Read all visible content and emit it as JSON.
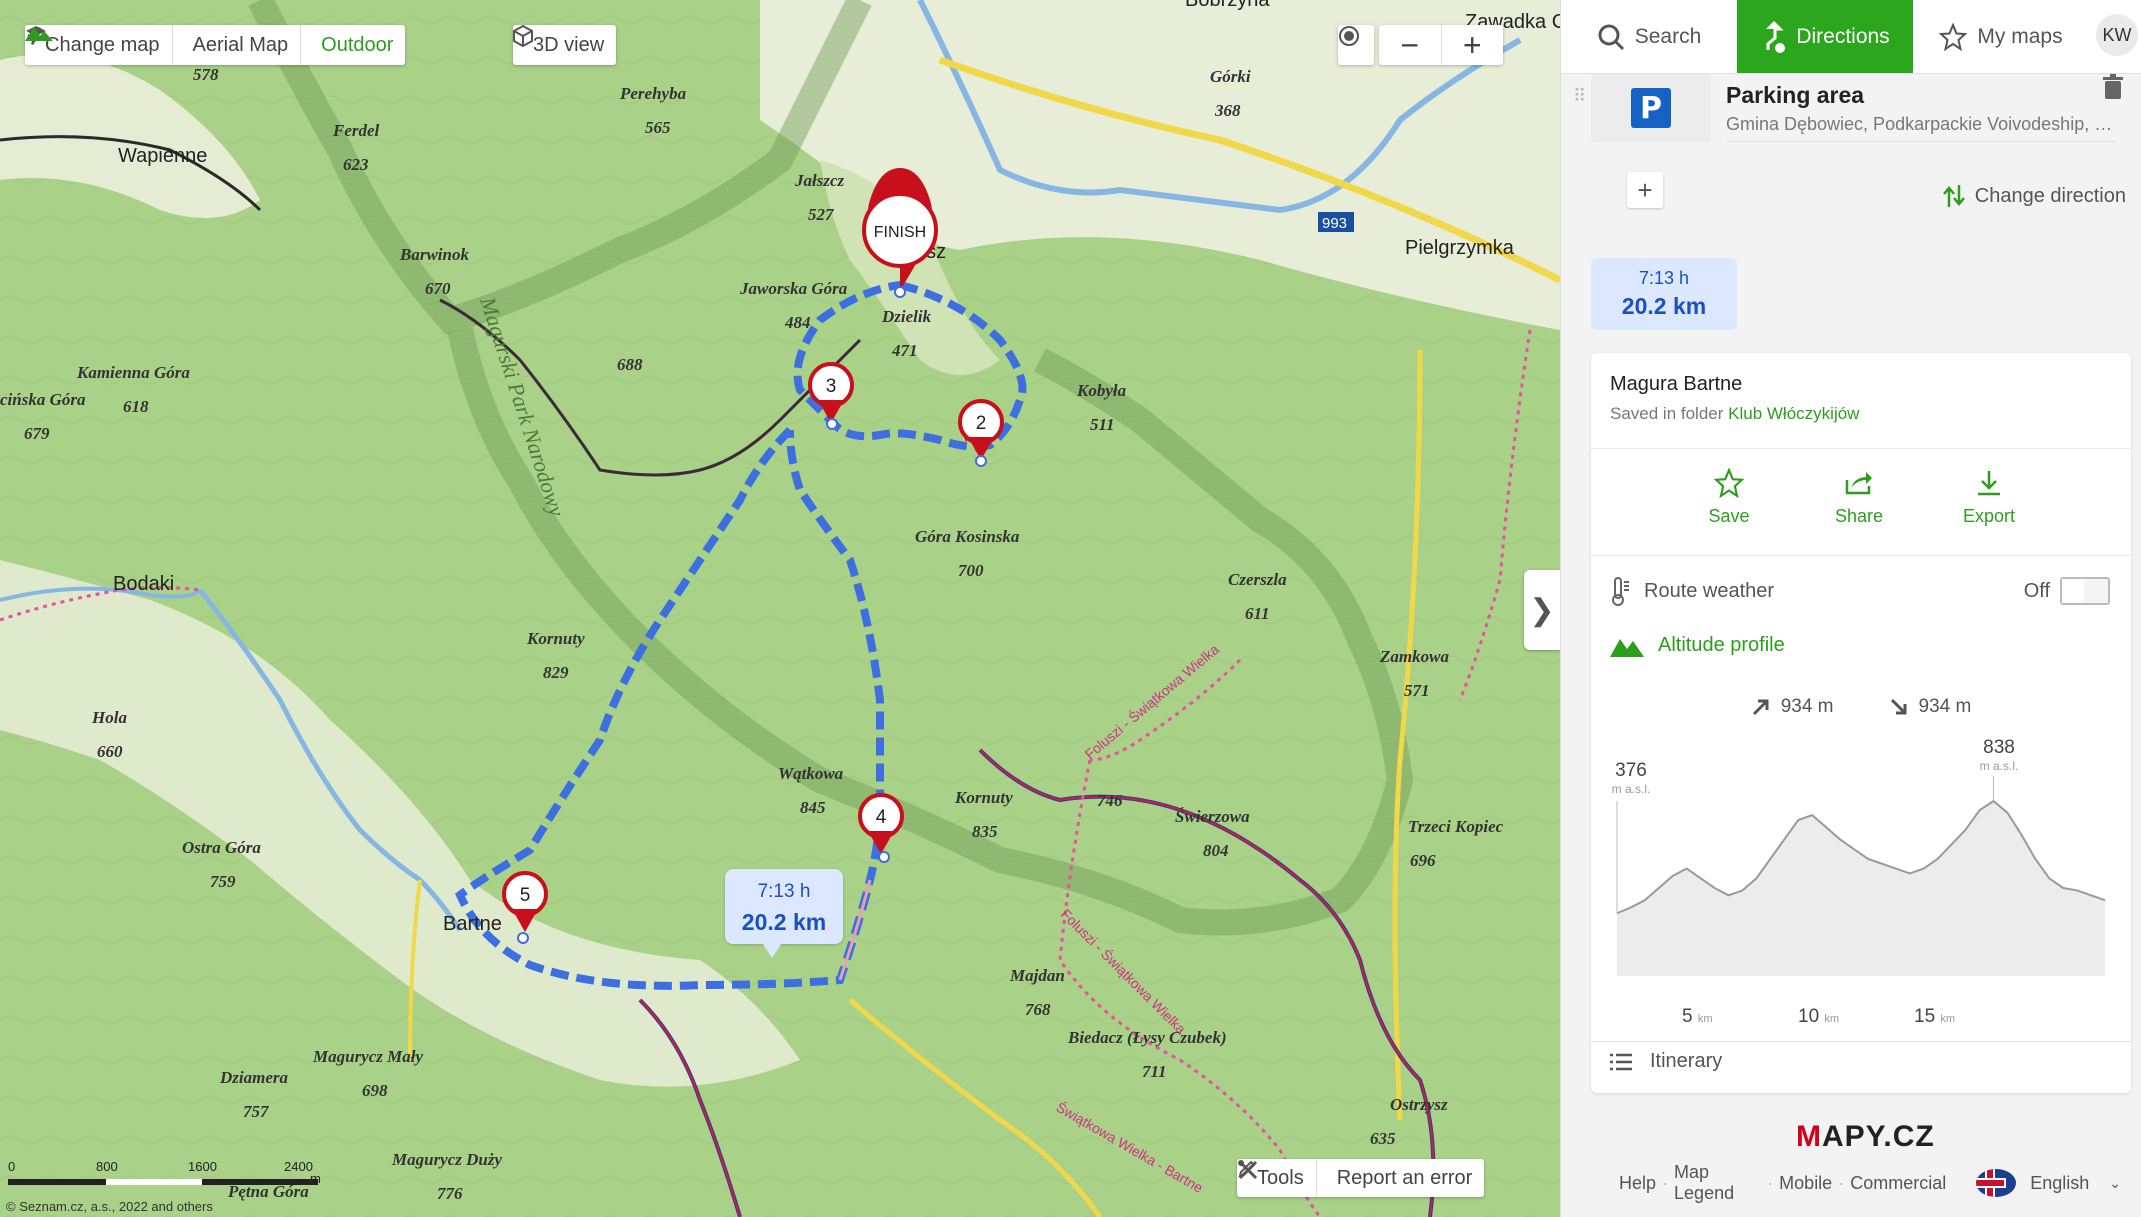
{
  "map_toolbar": {
    "change_map": "Change map",
    "aerial": "Aerial Map",
    "outdoor": "Outdoor",
    "view3d": "3D view",
    "zoom_out": "−",
    "zoom_in": "+"
  },
  "map_bottom": {
    "tools": "Tools",
    "report": "Report an error",
    "scale": [
      "0",
      "800",
      "1600",
      "2400",
      "m"
    ],
    "copyright": "© Seznam.cz, a.s., 2022 and others"
  },
  "route_label": {
    "time": "7:13 h",
    "distance": "20.2 km"
  },
  "markers": {
    "finish": "FINISH",
    "m2": "2",
    "m3": "3",
    "m4": "4",
    "m5": "5"
  },
  "places": {
    "wapienne": "Wapienne",
    "bodaki": "Bodaki",
    "bartne": "Bartne",
    "pielgrzymka": "Pielgrzymka",
    "zawadka": "Zawadka C",
    "bobrzyna": "Bobrzyna",
    "usz": "usz",
    "road993": "993"
  },
  "peaks": [
    {
      "name": "Perehyba",
      "alt": "565"
    },
    {
      "name": "Ferdel",
      "alt": "623"
    },
    {
      "name": "Barwinok",
      "alt": "670"
    },
    {
      "name": "Jałszcz",
      "alt": "527"
    },
    {
      "name": "Jaworska Góra",
      "alt": "484"
    },
    {
      "name": "Dzielik",
      "alt": "471"
    },
    {
      "name": "Górki",
      "alt": "368"
    },
    {
      "name": "Kobyła",
      "alt": "511"
    },
    {
      "name": "Kamienna Góra",
      "alt": "618"
    },
    {
      "name": "cińska Góra",
      "alt": "679"
    },
    {
      "name": "Góra Kosinska",
      "alt": "700"
    },
    {
      "name": "Czerszla",
      "alt": "611"
    },
    {
      "name": "Kornuty",
      "alt": "829"
    },
    {
      "name": "Zamkowa",
      "alt": "571"
    },
    {
      "name": "Hola",
      "alt": "660"
    },
    {
      "name": "Wątkowa",
      "alt": "845"
    },
    {
      "name": "Kornuty",
      "alt": "835"
    },
    {
      "name": "Świerzowa",
      "alt": "804"
    },
    {
      "name": "Trzeci Kopiec",
      "alt": "696"
    },
    {
      "name": "Ostra Góra",
      "alt": "759"
    },
    {
      "name": "Majdan",
      "alt": "768"
    },
    {
      "name": "Biedacz (Łysy Czubek)",
      "alt": "711"
    },
    {
      "name": "Magurycz Mały",
      "alt": "698"
    },
    {
      "name": "Dziamera",
      "alt": "757"
    },
    {
      "name": "Ostrzysz",
      "alt": "635"
    },
    {
      "name": "Magurycz Duży",
      "alt": "776"
    },
    {
      "name": "Pętna Góra",
      "alt": ""
    },
    {
      "name": "",
      "alt": "688"
    },
    {
      "name": "",
      "alt": "746"
    },
    {
      "name": "",
      "alt": "578"
    }
  ],
  "map_labels": {
    "park": "Magurski Park Narodowy",
    "trail1": "Foluszi - Świątkowa Wielka",
    "trail2": "Foluszi - Świątkowa Wielka",
    "trail3": "Świątkowa Wielka - Bartne"
  },
  "panel": {
    "tabs": {
      "search": "Search",
      "directions": "Directions",
      "mymaps": "My maps"
    },
    "avatar": "KW",
    "waypoint": {
      "title": "Parking area",
      "subtitle": "Gmina Dębowiec, Podkarpackie Voivodeship, Poland"
    },
    "change_direction": "Change direction",
    "summary": {
      "time": "7:13 h",
      "distance": "20.2 km"
    },
    "route": {
      "name": "Magura Bartne",
      "saved_prefix": "Saved in folder ",
      "folder": "Klub Włóczykijów",
      "actions": {
        "save": "Save",
        "share": "Share",
        "export": "Export"
      },
      "weather": {
        "label": "Route weather",
        "state": "Off"
      },
      "altitude": {
        "title": "Altitude profile",
        "ascent": "934 m",
        "descent": "934 m",
        "start": "376",
        "max": "838",
        "unit": "m a.s.l.",
        "km_ticks": [
          "5",
          "10",
          "15"
        ],
        "km_unit": "km",
        "profile": [
          376,
          400,
          430,
          480,
          530,
          560,
          520,
          480,
          450,
          470,
          520,
          600,
          680,
          760,
          780,
          730,
          680,
          640,
          600,
          580,
          560,
          540,
          560,
          600,
          660,
          720,
          800,
          838,
          790,
          700,
          600,
          520,
          480,
          470,
          450,
          430
        ]
      },
      "itinerary": "Itinerary"
    },
    "footer": {
      "logo_m": "M",
      "logo_rest": "APY.CZ",
      "links": [
        "Help",
        "Map Legend",
        "Mobile",
        "Commercial"
      ],
      "language": "English"
    }
  },
  "colors": {
    "accent": "#2ca61c",
    "route_blue": "#3d6fe0",
    "marker_red": "#c8101d",
    "label_bg": "#dce8ff"
  }
}
